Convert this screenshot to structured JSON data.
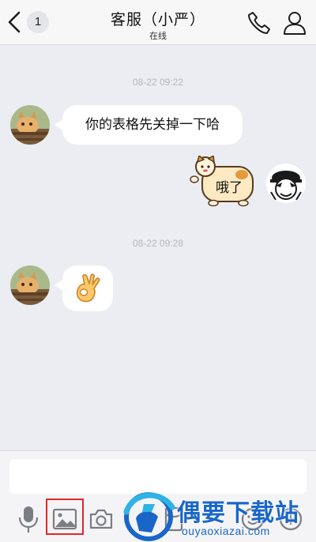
{
  "header": {
    "unread_count": "1",
    "title": "客服（小严）",
    "status": "在线"
  },
  "messages": [
    {
      "timestamp": "08-22 09:22"
    },
    {
      "sender": "other",
      "text": "你的表格先关掉一下哈"
    },
    {
      "sender": "self",
      "sticker_text": "哦了"
    },
    {
      "timestamp": "08-22 09:28"
    },
    {
      "sender": "other",
      "emoji": "👌"
    }
  ],
  "input": {
    "value": "",
    "placeholder": ""
  },
  "toolbar": {
    "tools": [
      "microphone-icon",
      "image-icon",
      "camera-icon",
      "hongbao-icon",
      "emoji-icon",
      "plus-icon"
    ]
  },
  "watermark": {
    "title": "偶要下载站",
    "url": "ouyaoxiazai.com"
  },
  "colors": {
    "background": "#ebedf2",
    "bubble": "#ffffff",
    "highlight": "#e2262b",
    "watermark": "#1a66c8"
  }
}
